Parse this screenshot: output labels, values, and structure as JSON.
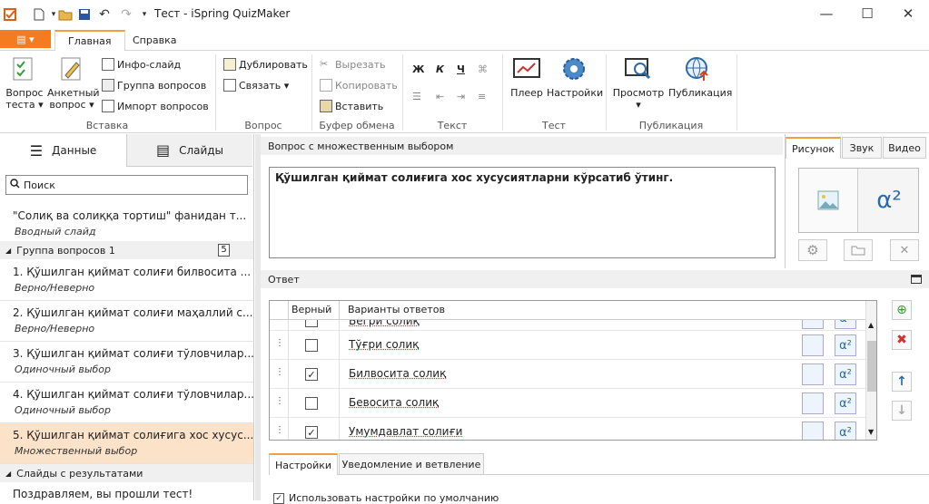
{
  "window": {
    "title": "Тест - iSpring QuizMaker"
  },
  "ribbon_tabs": {
    "file": "▤ ▾",
    "home": "Главная",
    "help": "Справка"
  },
  "ribbon": {
    "insert": {
      "question": "Вопрос\nтеста ▾",
      "survey": "Анкетный\nвопрос ▾",
      "info_slide": "Инфо-слайд",
      "question_group": "Группа вопросов",
      "import": "Импорт вопросов",
      "label": "Вставка"
    },
    "question": {
      "duplicate": "Дублировать",
      "link": "Связать ▾",
      "label": "Вопрос"
    },
    "clipboard": {
      "cut": "Вырезать",
      "copy": "Копировать",
      "paste": "Вставить",
      "label": "Буфер обмена"
    },
    "text": {
      "bold": "Ж",
      "italic": "К",
      "underline": "Ч",
      "label": "Текст"
    },
    "test": {
      "player": "Плеер",
      "settings": "Настройки",
      "label": "Тест"
    },
    "publish": {
      "preview": "Просмотр\n▾",
      "publish": "Публикация",
      "label": "Публикация"
    }
  },
  "left": {
    "tab_data": "Данные",
    "tab_slides": "Слайды",
    "search_placeholder": "Поиск",
    "intro": {
      "title": "\"Солиқ ва солиққа тортиш\" фанидан т...",
      "sub": "Вводный слайд"
    },
    "group": {
      "name": "Группа вопросов 1",
      "count": "5"
    },
    "items": [
      {
        "title": "1. Қўшилган қиймат солиғи билвосита ...",
        "sub": "Верно/Неверно"
      },
      {
        "title": "2. Қўшилган қиймат солиғи маҳаллий с...",
        "sub": "Верно/Неверно"
      },
      {
        "title": "3. Қўшилган қиймат солиғи тўловчилар...",
        "sub": "Одиночный выбор"
      },
      {
        "title": "4. Қўшилган қиймат солиғи тўловчилар...",
        "sub": "Одиночный выбор"
      },
      {
        "title": "5. Қўшилган қиймат солиғига хос хусус...",
        "sub": "Множественный выбор"
      }
    ],
    "results": {
      "name": "Слайды с результатами",
      "item": "Поздравляем, вы прошли тест!"
    }
  },
  "question": {
    "header": "Вопрос с множественным выбором",
    "text": "Қўшилган қиймат солиғига хос хусусиятларни кўрсатиб ўтинг.",
    "media_tabs": {
      "picture": "Рисунок",
      "sound": "Звук",
      "video": "Видео"
    },
    "formula_label": "α²"
  },
  "answer": {
    "header": "Ответ",
    "col_correct": "Верный",
    "col_variants": "Варианты ответов",
    "partial_row": "Бёгри солиқ",
    "rows": [
      {
        "text": "Тўғри солиқ",
        "checked": false
      },
      {
        "text": "Билвосита солиқ",
        "checked": true
      },
      {
        "text": "Бевосита солиқ",
        "checked": false
      },
      {
        "text": "Умумдавлат солиғи",
        "checked": true
      }
    ]
  },
  "bottom": {
    "tab_settings": "Настройки",
    "tab_feedback": "Уведомление и ветвление",
    "use_defaults": "Использовать настройки по умолчанию"
  },
  "colors": {
    "accent": "#f47b20",
    "selected": "#fbe2c9"
  }
}
